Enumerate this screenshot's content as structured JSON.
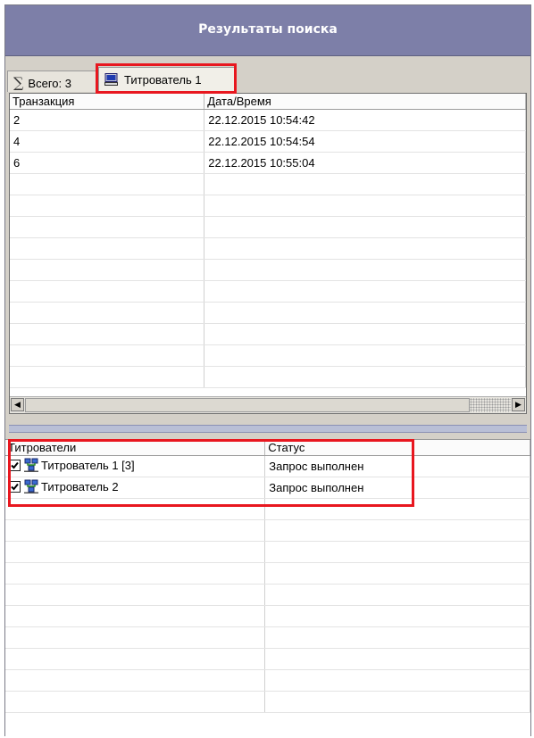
{
  "window": {
    "title": "Результаты поиска"
  },
  "tabs": {
    "total_label": "Всего: 3",
    "titrator_label": "Титрователь 1",
    "total_icon": "sigma-icon",
    "titrator_icon": "computer-icon"
  },
  "results_table": {
    "columns": [
      "Транзакция",
      "Дата/Время"
    ],
    "rows": [
      {
        "transaction": "2",
        "datetime": "22.12.2015 10:54:42"
      },
      {
        "transaction": "4",
        "datetime": "22.12.2015 10:54:54"
      },
      {
        "transaction": "6",
        "datetime": "22.12.2015 10:55:04"
      }
    ]
  },
  "titrators_table": {
    "columns": [
      "Титрователи",
      "Статус"
    ],
    "rows": [
      {
        "checked": true,
        "icon": "network-computers-icon",
        "name": "Титрователь 1 [3]",
        "status": "Запрос выполнен"
      },
      {
        "checked": true,
        "icon": "network-computers-icon",
        "name": "Титрователь 2",
        "status": "Запрос выполнен"
      }
    ]
  },
  "colors": {
    "titlebar": "#7d7fa8",
    "highlight": "#e8171f",
    "splitter": "#b9bfd6"
  }
}
